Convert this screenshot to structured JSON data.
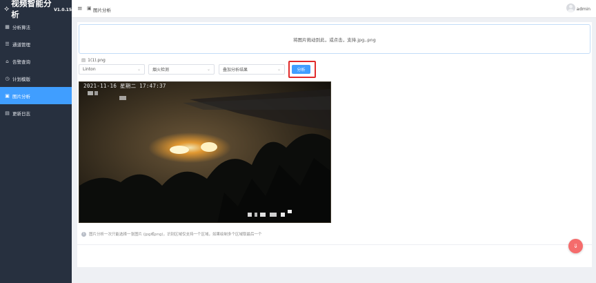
{
  "app": {
    "title": "视频智能分析",
    "version": "V1.0.15"
  },
  "sidebar": {
    "items": [
      {
        "label": "分析算法",
        "icon": "grid-icon",
        "glyph": "▦",
        "active": false
      },
      {
        "label": "通道管理",
        "icon": "list-icon",
        "glyph": "☰",
        "active": false
      },
      {
        "label": "告警查询",
        "icon": "home-icon",
        "glyph": "⌂",
        "active": false
      },
      {
        "label": "计划模版",
        "icon": "clock-icon",
        "glyph": "◷",
        "active": false
      },
      {
        "label": "图片分析",
        "icon": "image-icon",
        "glyph": "▣",
        "active": true
      },
      {
        "label": "更新日志",
        "icon": "document-icon",
        "glyph": "▤",
        "active": false
      }
    ]
  },
  "header": {
    "menu_glyph": "≡",
    "breadcrumb_glyph": "▣",
    "breadcrumb": "图片分析",
    "user": "admin"
  },
  "upload": {
    "text": "将图片拖动到此，或点击，支持.jpg,.png"
  },
  "file": {
    "glyph": "▤",
    "name": "1(1).png"
  },
  "selects": {
    "model": "Linton",
    "algorithm": "烟火检测",
    "mode": "叠加分析结果",
    "arrow": "⌄"
  },
  "analyze_button": "分析",
  "image": {
    "timestamp": "2021-11-16 星期二 17:47:37"
  },
  "hint": {
    "glyph": "i",
    "text": "图片分析一次只能选择一张图片 (jpg或png)，识别区域仅支持一个区域，如果绘制多个区域取最后一个"
  },
  "fab": {
    "glyph": "⇓"
  },
  "colors": {
    "sidebar_bg": "#27303f",
    "accent": "#409eff",
    "highlight_border": "#e02a2a",
    "fab": "#f56c6c"
  }
}
